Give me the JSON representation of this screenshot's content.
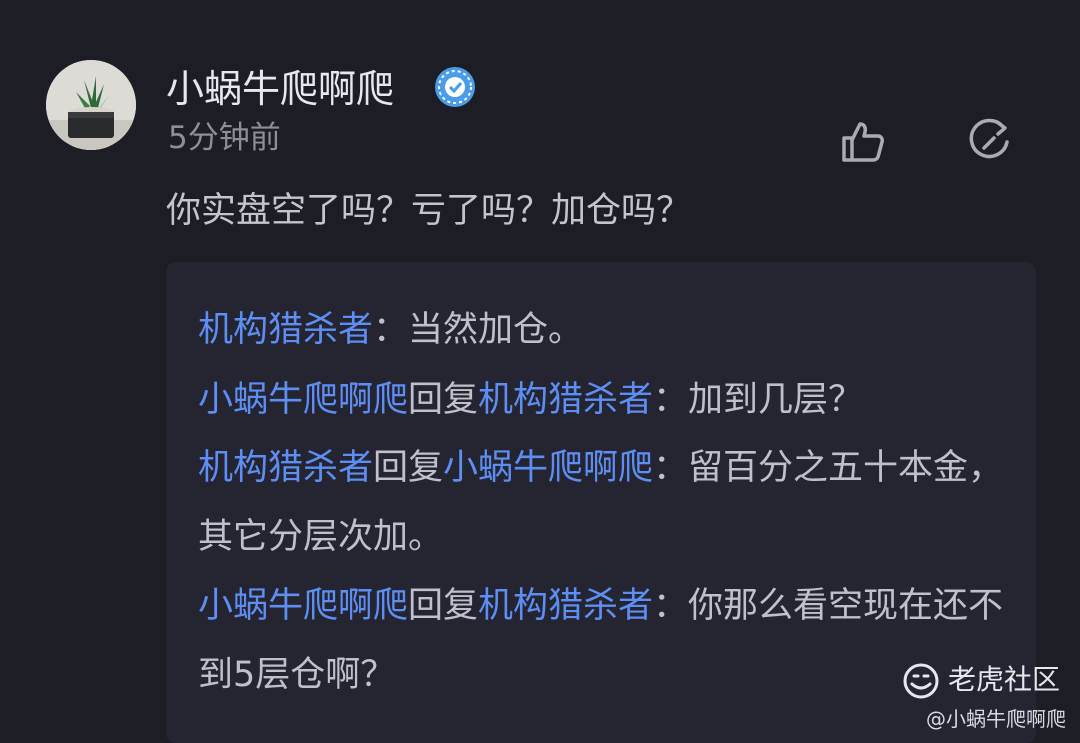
{
  "comment": {
    "username": "小蜗牛爬啊爬",
    "time": "5分钟前",
    "content": "你实盘空了吗？亏了吗？加仓吗？",
    "icons": {
      "avatar": "succulent-plant-avatar",
      "badge": "verified-badge-icon",
      "like": "thumbs-up-icon",
      "reply": "reply-icon"
    }
  },
  "replies": [
    {
      "author": "机构猎杀者",
      "connector": "",
      "target": "",
      "text": "：当然加仓。"
    },
    {
      "author": "小蜗牛爬啊爬",
      "connector": "回复",
      "target": "机构猎杀者",
      "text": "：加到几层？"
    },
    {
      "author": "机构猎杀者",
      "connector": "回复",
      "target": "小蜗牛爬啊爬",
      "text": "：留百分之五十本金，其它分层次加。"
    },
    {
      "author": "小蜗牛爬啊爬",
      "connector": "回复",
      "target": "机构猎杀者",
      "text": "：你那么看空现在还不到5层仓啊？"
    }
  ],
  "watermark": {
    "brand": "老虎社区",
    "user": "@小蜗牛爬啊爬"
  },
  "colors": {
    "background": "#1d1d26",
    "reply_box": "#252531",
    "link_blue": "#5d8ef5",
    "badge_blue": "#4a9be8"
  }
}
